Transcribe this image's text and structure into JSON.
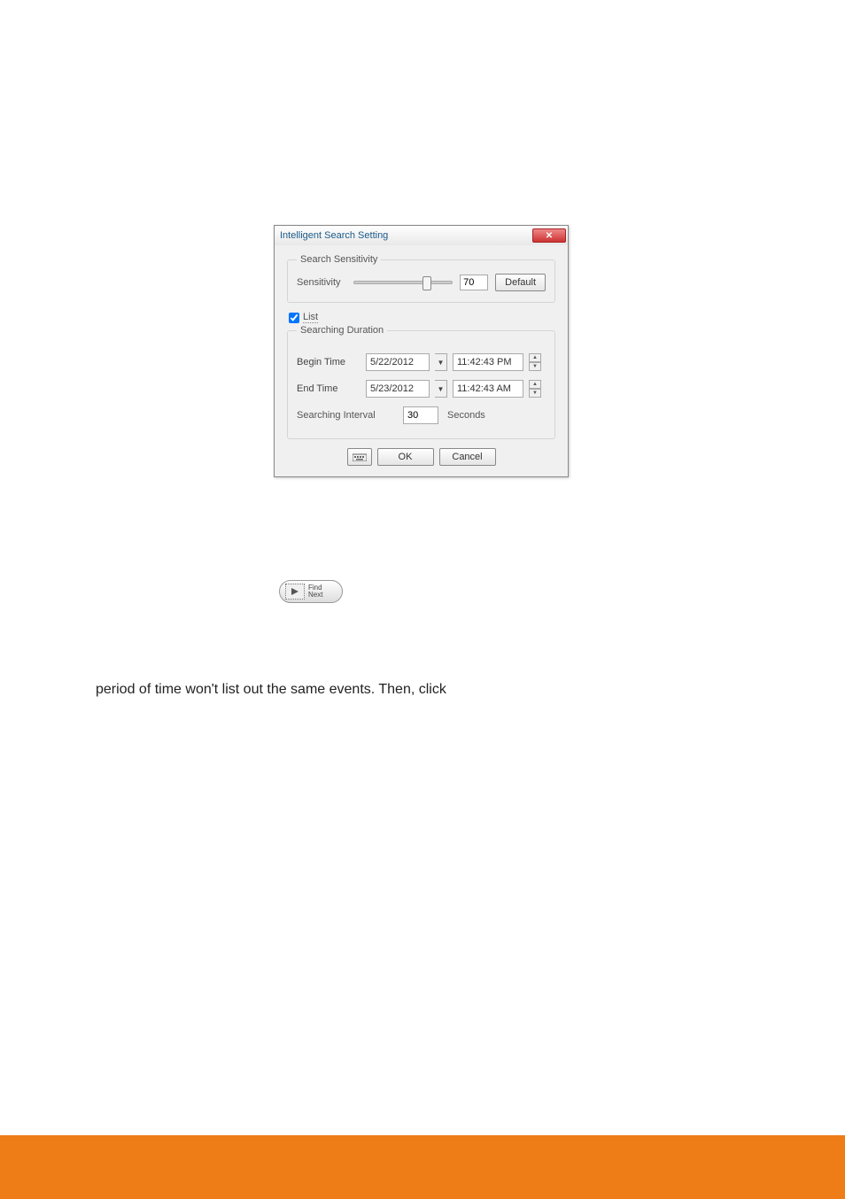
{
  "dialog": {
    "title": "Intelligent Search Setting",
    "sensitivity": {
      "group_label": "Search Sensitivity",
      "label": "Sensitivity",
      "value": "70",
      "default_btn": "Default"
    },
    "list_checkbox_label": "List",
    "duration": {
      "group_label": "Searching Duration",
      "begin_label": "Begin Time",
      "begin_date": "5/22/2012",
      "begin_time": "11:42:43 PM",
      "end_label": "End Time",
      "end_date": "5/23/2012",
      "end_time": "11:42:43 AM",
      "interval_label": "Searching Interval",
      "interval_value": "30",
      "interval_unit": "Seconds"
    },
    "buttons": {
      "ok": "OK",
      "cancel": "Cancel"
    }
  },
  "find_next": {
    "line1": "Find",
    "line2": "Next"
  },
  "body_text": "period of time won't list out the same events. Then, click"
}
